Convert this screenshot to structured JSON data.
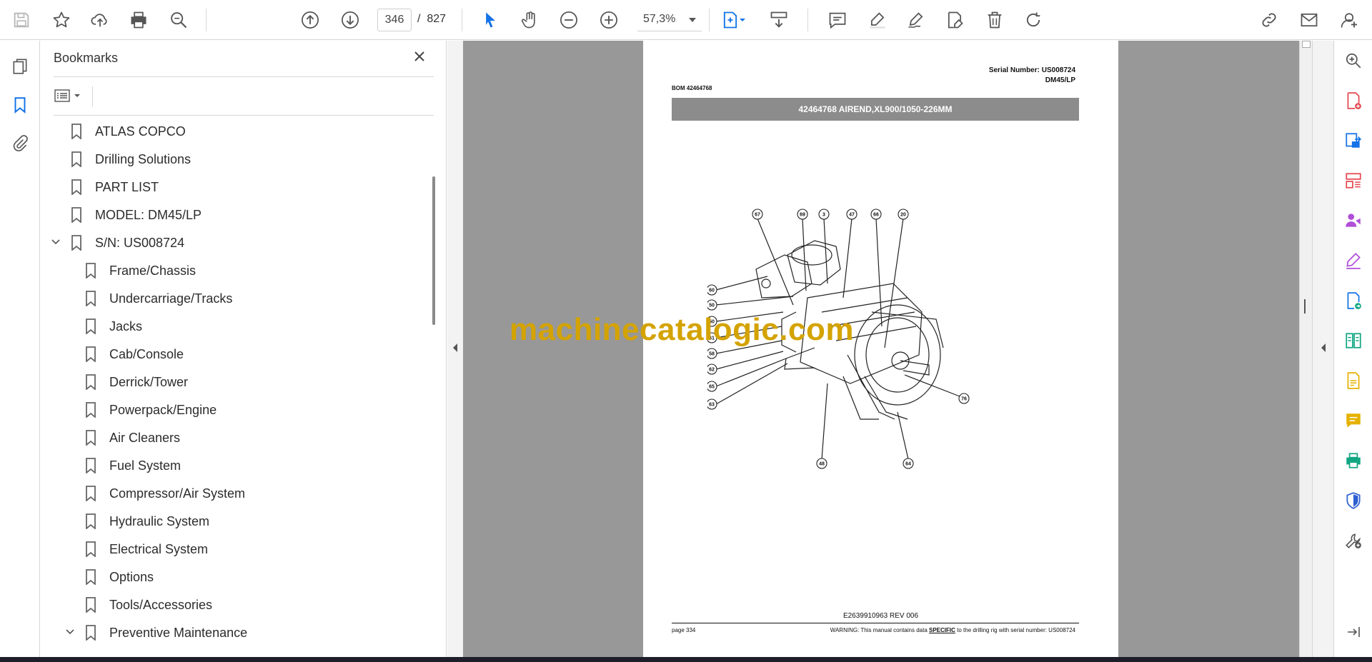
{
  "toolbar": {
    "page_current": "346",
    "page_separator": "/",
    "page_total": "827",
    "zoom": "57,3%",
    "icons": [
      "save-icon",
      "star-icon",
      "upload-icon",
      "print-icon",
      "zoom-search-icon",
      "page-up-icon",
      "page-down-icon",
      "select-cursor-icon",
      "hand-icon",
      "zoom-out-icon",
      "zoom-in-icon",
      "fit-page-icon",
      "scroll-mode-icon",
      "comment-icon",
      "highlight-icon",
      "sign-icon",
      "edit-icon",
      "delete-icon",
      "rotate-icon",
      "share-link-icon",
      "mail-icon",
      "account-icon"
    ]
  },
  "panel": {
    "title": "Bookmarks",
    "bookmarks": [
      {
        "label": "ATLAS COPCO",
        "level": 0
      },
      {
        "label": "Drilling Solutions",
        "level": 0
      },
      {
        "label": "PART LIST",
        "level": 0
      },
      {
        "label": "MODEL: DM45/LP",
        "level": 0
      },
      {
        "label": "S/N: US008724",
        "level": 0,
        "expanded": true
      },
      {
        "label": "Frame/Chassis",
        "level": 1
      },
      {
        "label": "Undercarriage/Tracks",
        "level": 1
      },
      {
        "label": "Jacks",
        "level": 1
      },
      {
        "label": "Cab/Console",
        "level": 1
      },
      {
        "label": "Derrick/Tower",
        "level": 1
      },
      {
        "label": "Powerpack/Engine",
        "level": 1
      },
      {
        "label": "Air Cleaners",
        "level": 1
      },
      {
        "label": "Fuel System",
        "level": 1
      },
      {
        "label": "Compressor/Air System",
        "level": 1
      },
      {
        "label": "Hydraulic System",
        "level": 1
      },
      {
        "label": "Electrical System",
        "level": 1
      },
      {
        "label": "Options",
        "level": 1
      },
      {
        "label": "Tools/Accessories",
        "level": 1
      },
      {
        "label": "Preventive Maintenance",
        "level": 1,
        "expanded": true
      }
    ]
  },
  "document": {
    "serial_line1": "Serial Number: US008724",
    "serial_line2": "DM45/LP",
    "bom": "BOM 42464768",
    "title": "42464768 AIREND,XL900/1050-226MM",
    "callouts": [
      "67",
      "69",
      "3",
      "47",
      "66",
      "20",
      "60",
      "50",
      "50",
      "61",
      "58",
      "62",
      "65",
      "63",
      "48",
      "64",
      "76"
    ],
    "doc_number": "E2639910963 REV 006",
    "page_label": "page 334",
    "warning_prefix": "WARNING:  This manual contains data ",
    "warning_emph": "SPECIFIC",
    "warning_suffix": " to the drilling rig with serial number: US008724"
  },
  "watermark": "machinecatalogic.com",
  "colors": {
    "accent_blue": "#1473e6",
    "watermark": "#d4a300",
    "title_bar": "#8c8c8c",
    "doc_background": "#989898"
  }
}
